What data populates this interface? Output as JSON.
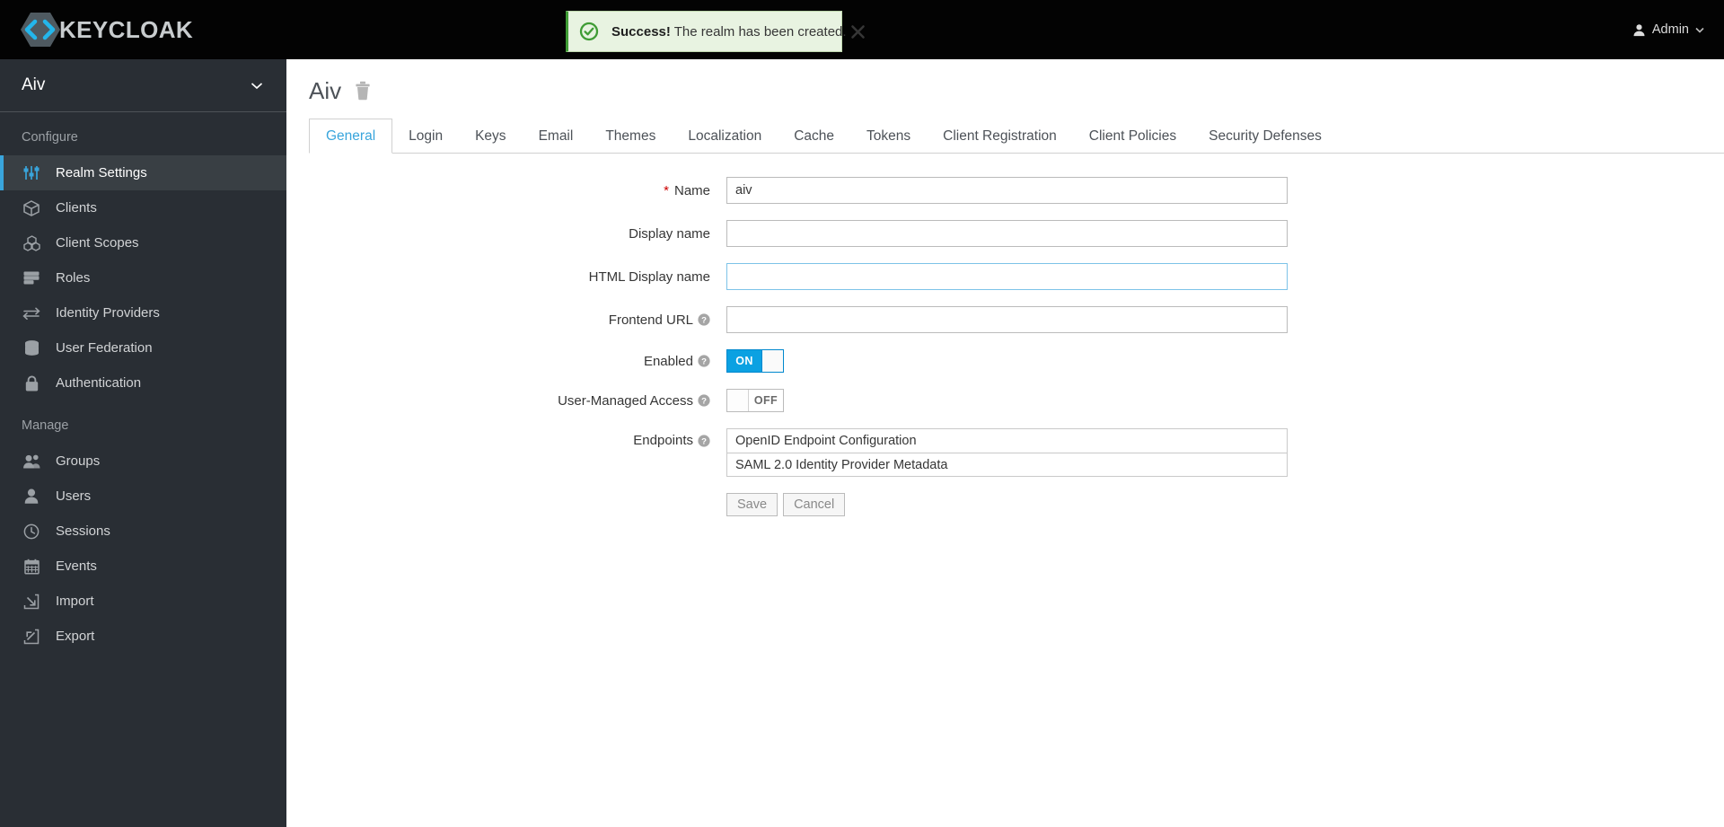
{
  "masthead": {
    "brand_name": "KEYCLOAK",
    "brand_icon": "keycloak-hexagon-logo",
    "user_label": "Admin",
    "user_icon": "user-icon",
    "caret_icon": "chevron-down-icon"
  },
  "alert": {
    "icon": "check-circle-icon",
    "strong": "Success!",
    "message": " The realm has been created.",
    "close_icon": "close-icon",
    "accent_color": "#3f9c35",
    "background_color": "#e8f3e1"
  },
  "sidebar": {
    "realm": {
      "name": "Aiv",
      "caret_icon": "chevron-down-icon"
    },
    "groups": [
      {
        "title": "Configure",
        "items": [
          {
            "label": "Realm Settings",
            "icon": "sliders-icon",
            "active": true
          },
          {
            "label": "Clients",
            "icon": "cube-icon",
            "active": false
          },
          {
            "label": "Client Scopes",
            "icon": "cubes-icon",
            "active": false
          },
          {
            "label": "Roles",
            "icon": "list-bars-icon",
            "active": false
          },
          {
            "label": "Identity Providers",
            "icon": "exchange-arrows-icon",
            "active": false
          },
          {
            "label": "User Federation",
            "icon": "database-icon",
            "active": false
          },
          {
            "label": "Authentication",
            "icon": "lock-icon",
            "active": false
          }
        ]
      },
      {
        "title": "Manage",
        "items": [
          {
            "label": "Groups",
            "icon": "users-group-icon",
            "active": false
          },
          {
            "label": "Users",
            "icon": "user-icon",
            "active": false
          },
          {
            "label": "Sessions",
            "icon": "clock-icon",
            "active": false
          },
          {
            "label": "Events",
            "icon": "calendar-icon",
            "active": false
          },
          {
            "label": "Import",
            "icon": "import-arrow-icon",
            "active": false
          },
          {
            "label": "Export",
            "icon": "export-arrow-icon",
            "active": false
          }
        ]
      }
    ],
    "active_accent_color": "#39a5dc"
  },
  "page": {
    "title": "Aiv",
    "delete_icon": "trash-icon",
    "tabs": [
      {
        "label": "General",
        "active": true
      },
      {
        "label": "Login",
        "active": false
      },
      {
        "label": "Keys",
        "active": false
      },
      {
        "label": "Email",
        "active": false
      },
      {
        "label": "Themes",
        "active": false
      },
      {
        "label": "Localization",
        "active": false
      },
      {
        "label": "Cache",
        "active": false
      },
      {
        "label": "Tokens",
        "active": false
      },
      {
        "label": "Client Registration",
        "active": false
      },
      {
        "label": "Client Policies",
        "active": false
      },
      {
        "label": "Security Defenses",
        "active": false
      }
    ],
    "active_tab_color": "#39a5dc"
  },
  "form": {
    "name": {
      "label": "Name",
      "required_marker": "*",
      "value": "aiv",
      "placeholder": ""
    },
    "display_name": {
      "label": "Display name",
      "value": "",
      "placeholder": ""
    },
    "html_display_name": {
      "label": "HTML Display name",
      "value": "",
      "placeholder": "",
      "focused": true
    },
    "frontend_url": {
      "label": "Frontend URL",
      "value": "",
      "placeholder": "",
      "help_icon": "question-circle-icon"
    },
    "enabled": {
      "label": "Enabled",
      "help_icon": "question-circle-icon",
      "state": "ON"
    },
    "user_managed_access": {
      "label": "User-Managed Access",
      "help_icon": "question-circle-icon",
      "state": "OFF"
    },
    "endpoints": {
      "label": "Endpoints",
      "help_icon": "question-circle-icon",
      "links": [
        "OpenID Endpoint Configuration",
        "SAML 2.0 Identity Provider Metadata"
      ]
    },
    "save_label": "Save",
    "cancel_label": "Cancel"
  }
}
